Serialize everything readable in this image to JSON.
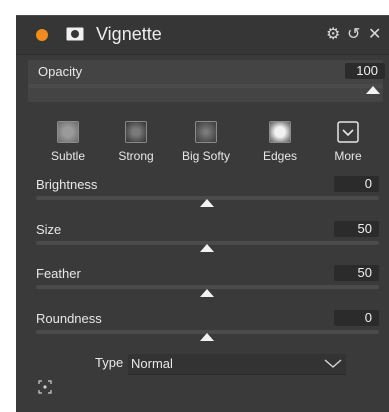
{
  "panel": {
    "title": "Vignette",
    "accent_color": "#f28c1e"
  },
  "header_icons": {
    "settings": "gear-icon",
    "reset": "reset-icon",
    "close": "close-icon"
  },
  "opacity": {
    "label": "Opacity",
    "value": "100",
    "level": 1.0
  },
  "presets": [
    {
      "label": "Subtle",
      "icon": "preset-subtle-icon"
    },
    {
      "label": "Strong",
      "icon": "preset-strong-icon"
    },
    {
      "label": "Big Softy",
      "icon": "preset-big-softy-icon"
    },
    {
      "label": "Edges",
      "icon": "preset-edges-icon"
    },
    {
      "label": "More",
      "icon": "chevron-down-icon"
    }
  ],
  "sliders": [
    {
      "label": "Brightness",
      "value": "0",
      "level": 0.5
    },
    {
      "label": "Size",
      "value": "50",
      "level": 0.5
    },
    {
      "label": "Feather",
      "value": "50",
      "level": 0.5
    },
    {
      "label": "Roundness",
      "value": "0",
      "level": 0.5
    }
  ],
  "type": {
    "label": "Type",
    "value": "Normal"
  },
  "footer": {
    "icon": "focus-target-icon"
  }
}
